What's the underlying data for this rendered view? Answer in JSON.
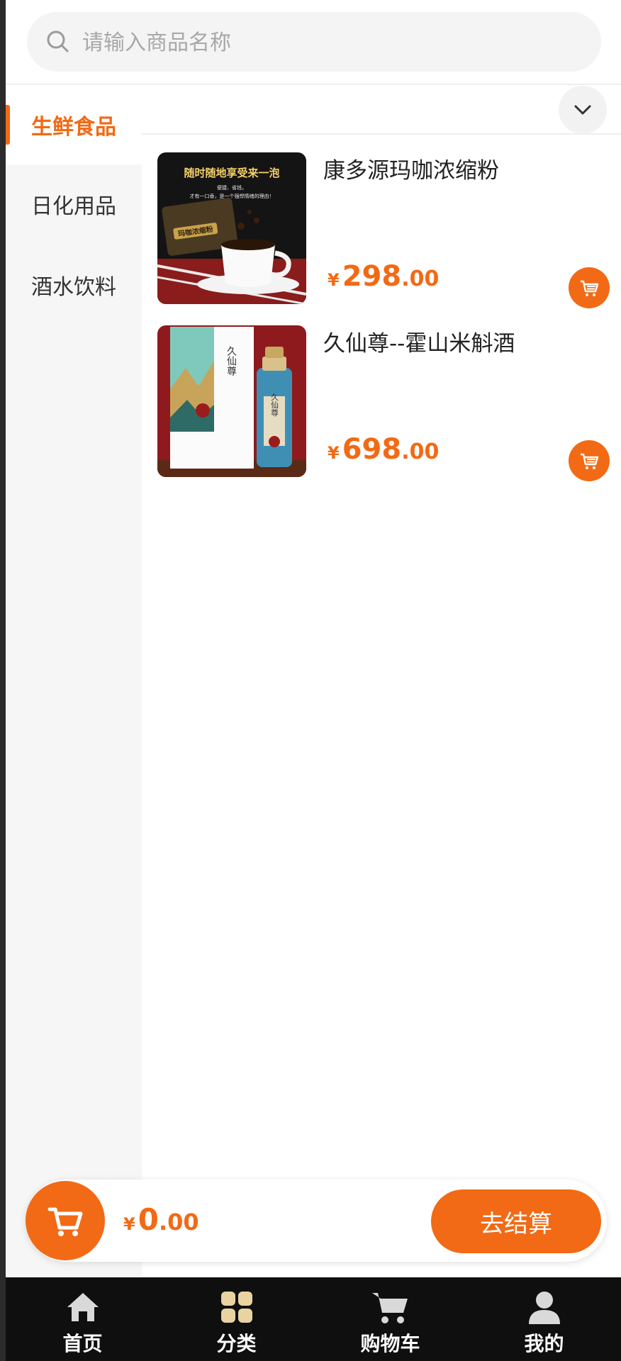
{
  "search": {
    "placeholder": "请输入商品名称"
  },
  "sidebar": {
    "items": [
      {
        "label": "生鲜食品",
        "active": true
      },
      {
        "label": "日化用品",
        "active": false
      },
      {
        "label": "酒水饮料",
        "active": false
      }
    ]
  },
  "products": [
    {
      "name": "康多源玛咖浓缩粉",
      "currency": "¥",
      "price_int": "298",
      "price_dec": ".00",
      "image_text": {
        "banner": "随时随地享受来一泡",
        "sub1": "便捷、省钱，",
        "sub2": "才有一口香，是一个强悍情绪的理由！",
        "box": "玛咖浓缩粉"
      }
    },
    {
      "name": "久仙尊--霍山米斛酒",
      "currency": "¥",
      "price_int": "698",
      "price_dec": ".00",
      "image_text": {
        "box": "久仙尊",
        "bottle": "久仙尊"
      }
    }
  ],
  "cart": {
    "currency": "¥",
    "total_int": "0",
    "total_dec": ".00",
    "checkout_label": "去结算"
  },
  "tabbar": {
    "items": [
      {
        "label": "首页",
        "icon": "home-icon"
      },
      {
        "label": "分类",
        "icon": "category-icon"
      },
      {
        "label": "购物车",
        "icon": "cart-icon"
      },
      {
        "label": "我的",
        "icon": "user-icon"
      }
    ]
  },
  "colors": {
    "accent": "#f26a15",
    "sidebar_bg": "#f6f6f6",
    "tabbar_bg": "#0f0f0f"
  }
}
